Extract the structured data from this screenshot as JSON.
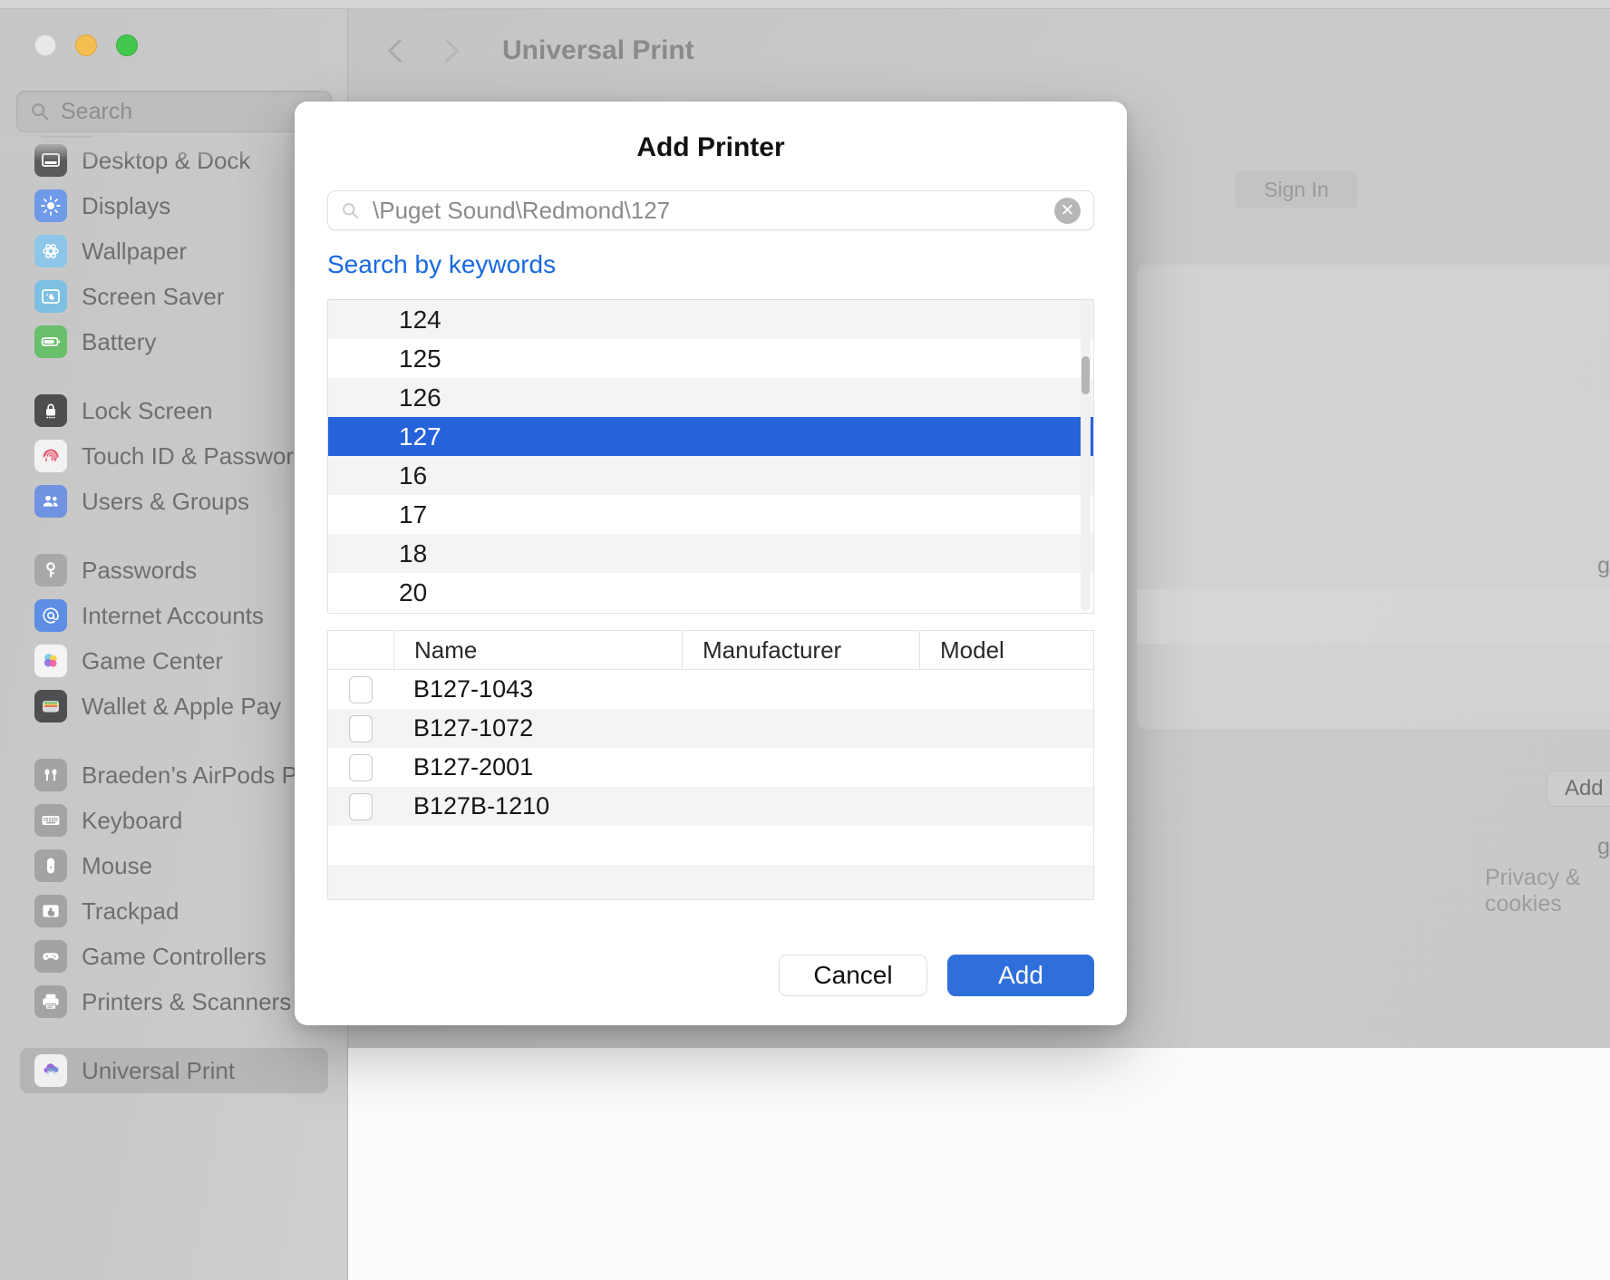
{
  "window": {
    "traffic_lights": [
      "close",
      "minimize",
      "maximize"
    ],
    "sidebar_search_placeholder": "Search",
    "title": "Universal Print"
  },
  "sidebar": {
    "groups": [
      {
        "items": [
          {
            "label": "Desktop & Dock",
            "icon": "desktop-dock-icon",
            "color": "#5a5a5c"
          },
          {
            "label": "Displays",
            "icon": "displays-icon",
            "color": "#6f9ae8"
          },
          {
            "label": "Wallpaper",
            "icon": "wallpaper-icon",
            "color": "#8dc6e8"
          },
          {
            "label": "Screen Saver",
            "icon": "screen-saver-icon",
            "color": "#7dc0e3"
          },
          {
            "label": "Battery",
            "icon": "battery-icon",
            "color": "#69bf6b"
          }
        ]
      },
      {
        "items": [
          {
            "label": "Lock Screen",
            "icon": "lock-screen-icon",
            "color": "#4e4e50"
          },
          {
            "label": "Touch ID & Password",
            "icon": "touch-id-icon",
            "color": "#f2f2f2"
          },
          {
            "label": "Users & Groups",
            "icon": "users-groups-icon",
            "color": "#6f93e0"
          }
        ]
      },
      {
        "items": [
          {
            "label": "Passwords",
            "icon": "passwords-key-icon",
            "color": "#a8a8a8"
          },
          {
            "label": "Internet Accounts",
            "icon": "internet-accounts-icon",
            "color": "#5d8ee4"
          },
          {
            "label": "Game Center",
            "icon": "game-center-icon",
            "color": "#f4f4f4"
          },
          {
            "label": "Wallet & Apple Pay",
            "icon": "wallet-icon",
            "color": "#4f4f51"
          }
        ]
      },
      {
        "items": [
          {
            "label": "Braeden’s AirPods Pro",
            "icon": "airpods-icon",
            "color": "#a3a3a3"
          },
          {
            "label": "Keyboard",
            "icon": "keyboard-icon",
            "color": "#a3a3a3"
          },
          {
            "label": "Mouse",
            "icon": "mouse-icon",
            "color": "#a3a3a3"
          },
          {
            "label": "Trackpad",
            "icon": "trackpad-icon",
            "color": "#a3a3a3"
          },
          {
            "label": "Game Controllers",
            "icon": "game-controllers-icon",
            "color": "#a3a3a3"
          },
          {
            "label": "Printers & Scanners",
            "icon": "printers-scanners-icon",
            "color": "#a3a3a3"
          }
        ]
      },
      {
        "items": [
          {
            "label": "Universal Print",
            "icon": "universal-print-icon",
            "color": "#f0f0f0",
            "selected": true
          }
        ]
      }
    ]
  },
  "content": {
    "title": "Universal Print",
    "sign_in_label": "Sign In",
    "add_printer_label": "Add printer...",
    "privacy_label": "Privacy & cookies",
    "help_label": "?"
  },
  "modal": {
    "title": "Add Printer",
    "search": {
      "value": "\\Puget Sound\\Redmond\\127",
      "clear_label": "✕"
    },
    "keywords_link": "Search by keywords",
    "locations": [
      {
        "label": "124"
      },
      {
        "label": "125"
      },
      {
        "label": "126"
      },
      {
        "label": "127",
        "selected": true
      },
      {
        "label": "16"
      },
      {
        "label": "17"
      },
      {
        "label": "18"
      },
      {
        "label": "20"
      }
    ],
    "table": {
      "columns": [
        "",
        "Name",
        "Manufacturer",
        "Model"
      ],
      "rows": [
        {
          "checked": false,
          "name": "B127-1043",
          "manufacturer": "",
          "model": ""
        },
        {
          "checked": false,
          "name": "B127-1072",
          "manufacturer": "",
          "model": ""
        },
        {
          "checked": false,
          "name": "B127-2001",
          "manufacturer": "",
          "model": ""
        },
        {
          "checked": false,
          "name": "B127B-1210",
          "manufacturer": "",
          "model": ""
        }
      ]
    },
    "buttons": {
      "cancel": "Cancel",
      "add": "Add"
    },
    "accent_color": "#2f6fdc",
    "selection_color": "#2563db"
  }
}
